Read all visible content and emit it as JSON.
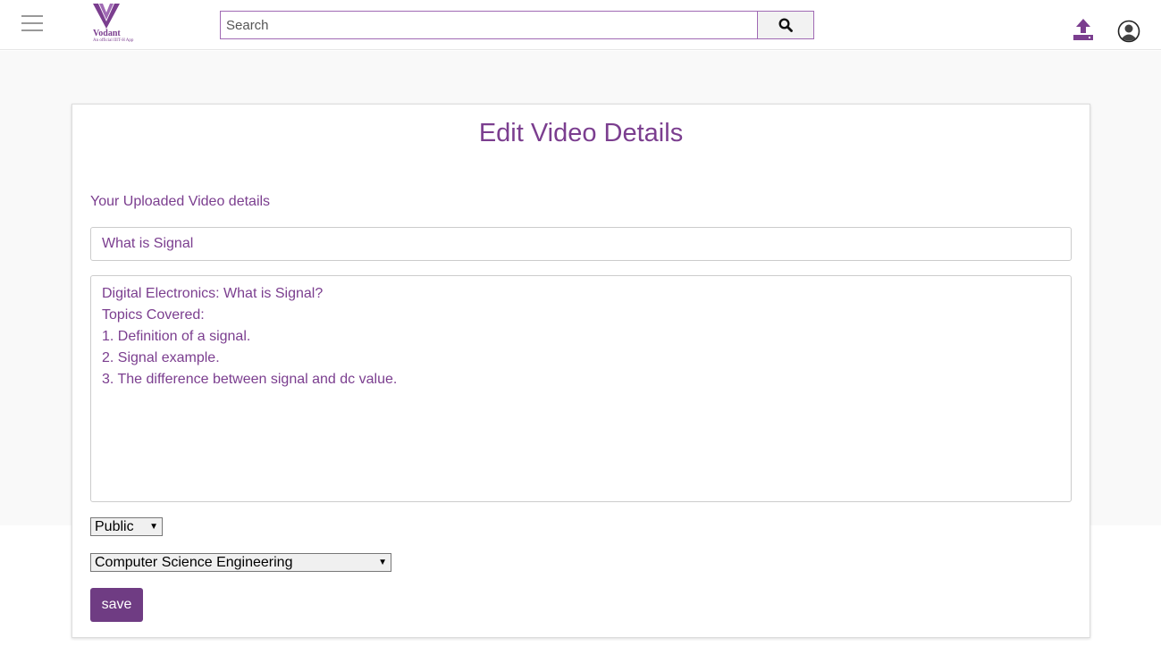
{
  "header": {
    "logo_text": "Vodant",
    "logo_subtext": "An official IIIT-H App",
    "search_placeholder": "Search"
  },
  "colors": {
    "accent": "#7b3e8f",
    "button": "#6f3c83",
    "background_band": "#f9f9f9"
  },
  "form": {
    "title": "Edit Video Details",
    "subtitle": "Your Uploaded Video details",
    "video_title_value": "What is Signal",
    "description_lines": [
      "Digital Electronics: What is Signal?",
      "Topics Covered:",
      "1. Definition of a signal.",
      "2. Signal example.",
      "3. The difference between signal and dc value."
    ],
    "visibility_selected": "Public",
    "category_selected": "Computer Science Engineering",
    "save_label": "save"
  },
  "icons": {
    "menu": "hamburger-menu-icon",
    "search": "magnifier-icon",
    "upload": "upload-icon",
    "account": "account-circle-icon"
  }
}
